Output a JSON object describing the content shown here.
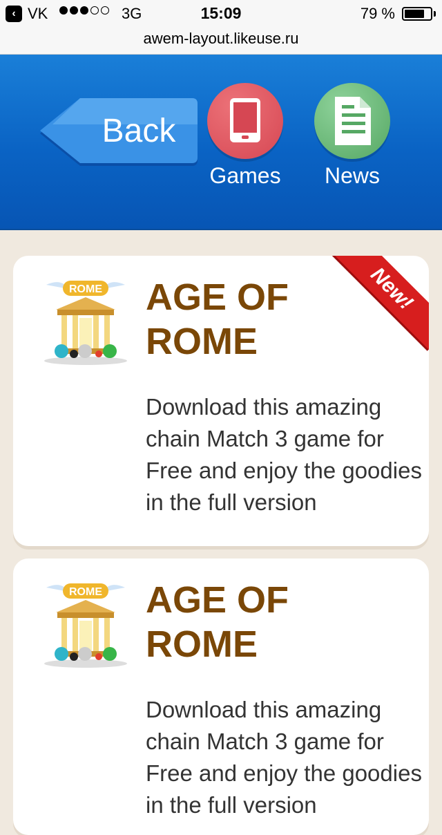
{
  "status_bar": {
    "carrier": "VK",
    "network": "3G",
    "time": "15:09",
    "battery": "79 %",
    "battery_level": 0.79
  },
  "url_bar": {
    "url": "awem-layout.likeuse.ru"
  },
  "header": {
    "back_label": "Back",
    "nav": [
      {
        "label": "Games",
        "icon": "tablet-icon",
        "color": "#d64753"
      },
      {
        "label": "News",
        "icon": "document-icon",
        "color": "#56a864"
      }
    ]
  },
  "cards": [
    {
      "title": "AGE OF ROME",
      "badge": "New!",
      "description": "Download this amazing chain Match 3 game for Free and enjoy the goodies in the full version",
      "thumb_label": "ROME"
    },
    {
      "title": "AGE OF ROME",
      "description": "Download this amazing chain Match 3 game for Free and enjoy the goodies in the full version",
      "thumb_label": "ROME"
    }
  ],
  "colors": {
    "header_blue": "#0a63c4",
    "title_brown": "#7a4707",
    "ribbon_red": "#d71e1e",
    "page_bg": "#f0e9df"
  }
}
